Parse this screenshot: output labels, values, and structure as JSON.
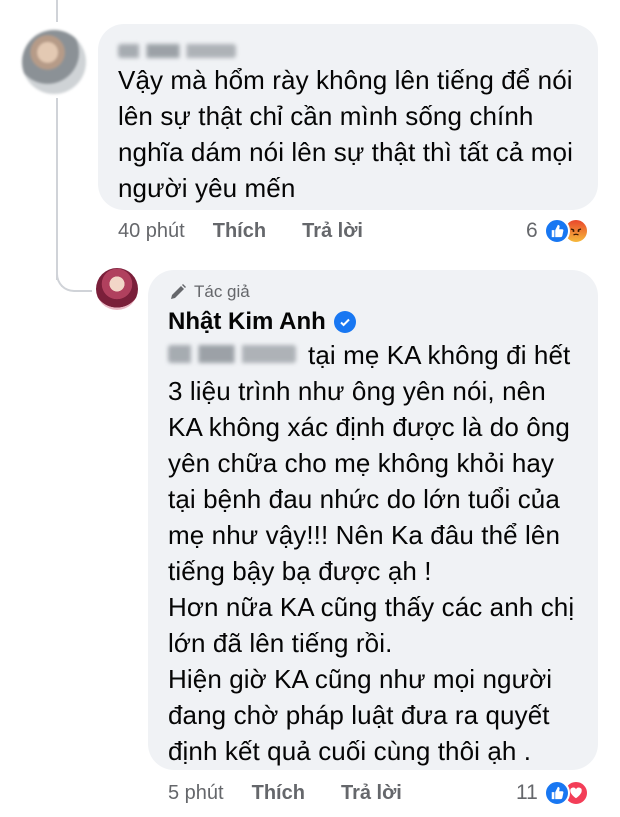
{
  "comment1": {
    "text": "Vậy mà hổm rày không lên tiếng để nói\nlên sự thật chỉ cần mình sống chính\nnghĩa dám nói lên sự thật thì tất cả mọi\nngười yêu mến",
    "time": "40 phút",
    "like_label": "Thích",
    "reply_label": "Trả lời",
    "reaction_count": "6",
    "reactions": [
      "like-icon",
      "angry-icon"
    ]
  },
  "reply": {
    "author_badge": "Tác giả",
    "author_name": "Nhật Kim Anh",
    "text_first_line": "tại mẹ KA không đi hết",
    "text_rest": "3 liệu trình như ông yên nói, nên\nKA không xác định được là do ông\nyên chữa cho mẹ không khỏi hay\ntại bệnh đau nhức do lớn tuổi của\nmẹ như vậy!!! Nên Ka đâu thể lên\ntiếng bậy bạ được ạh !",
    "text_para2": "Hơn nữa KA cũng thấy các anh chị\nlớn đã lên tiếng rồi.\nHiện giờ KA cũng như mọi người\nđang chờ pháp luật đưa ra quyết\nđịnh kết quả cuối cùng thôi ạh .",
    "time": "5 phút",
    "like_label": "Thích",
    "reply_label": "Trả lời",
    "reaction_count": "11",
    "reactions": [
      "like-icon",
      "love-icon"
    ]
  },
  "colors": {
    "bubble": "#f0f2f5",
    "meta": "#65676b",
    "like": "#1877f2",
    "love": "#f33e58"
  }
}
